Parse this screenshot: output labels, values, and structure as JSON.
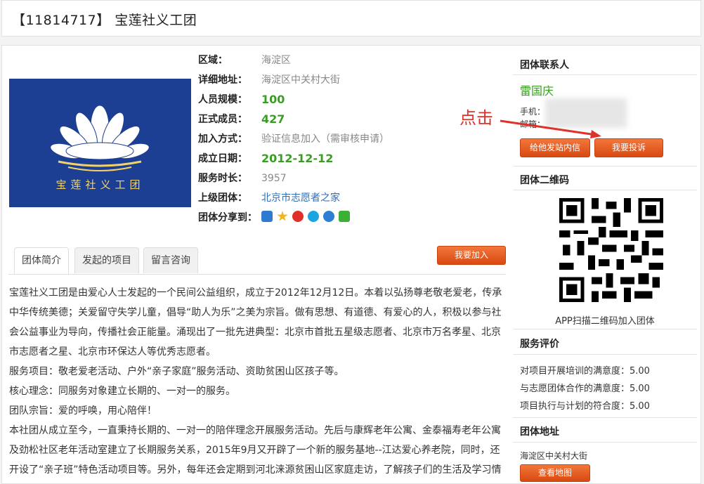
{
  "header": {
    "title": "【11814717】 宝莲社义工团"
  },
  "logo": {
    "text": "宝莲社义工团"
  },
  "info": [
    {
      "label": "区域：",
      "value": "海淀区",
      "style": "gray"
    },
    {
      "label": "详细地址：",
      "value": "海淀区中关村大街",
      "style": "gray"
    },
    {
      "label": "人员规模：",
      "value": "100",
      "style": "green"
    },
    {
      "label": "正式成员：",
      "value": "427",
      "style": "green"
    },
    {
      "label": "加入方式：",
      "value": "验证信息加入（需审核申请）",
      "style": "gray"
    },
    {
      "label": "成立日期：",
      "value": "2012-12-12",
      "style": "green"
    },
    {
      "label": "服务时长：",
      "value": "3957",
      "style": "gray"
    },
    {
      "label": "上级团体：",
      "value": "北京市志愿者之家",
      "style": "link"
    },
    {
      "label": "团体分享到：",
      "value": "",
      "style": "share"
    }
  ],
  "share_icons": [
    "qzone-icon",
    "star-icon",
    "weibo-icon",
    "pengyou-icon",
    "tencent-weibo-icon",
    "wechat-icon"
  ],
  "tabs": [
    "团体简介",
    "发起的项目",
    "留言咨询"
  ],
  "join_button": "我要加入",
  "description": [
    "宝莲社义工团是由爱心人士发起的一个民间公益组织，成立于2012年12月12日。本着以弘扬尊老敬老爱老，传承中华传统美德；关爱留守失学儿童，倡导“助人为乐”之美为宗旨。做有思想、有道德、有爱心的人，积极以参与社会公益事业为导向，传播社会正能量。涌现出了一批先进典型：北京市首批五星级志愿者、北京市万名孝星、北京市志愿者之星、北京市环保达人等优秀志愿者。",
    "服务项目：敬老爱老活动、户外“亲子家庭”服务活动、资助贫困山区孩子等。",
    "核心理念：同服务对象建立长期的、一对一的服务。",
    "团队宗旨：爱的呼唤，用心陪伴！",
    "本社团从成立至今，一直秉持长期的、一对一的陪伴理念开展服务活动。先后与康辉老年公寓、金泰福寿老年公寓及劲松社区老年活动室建立了长期服务关系，2015年9月又开辟了一个新的服务基地--江达爱心养老院，同时，还开设了“亲子班”特色活动项目等。另外，每年还会定期到河北涞源贫困山区家庭走访，了解孩子们的生活及学习情"
  ],
  "sidebar": {
    "contact_title": "团体联系人",
    "contact_name": "雷国庆",
    "phone_label": "手机：",
    "email_label": "邮箱：",
    "message_button": "给他发站内信",
    "complain_button": "我要投诉",
    "qr_title": "团体二维码",
    "qr_caption": "APP扫描二维码加入团体",
    "eval_title": "服务评价",
    "evals": [
      "对项目开展培训的满意度：5.00",
      "与志愿团体合作的满意度：5.00",
      "项目执行与计划的符合度：5.00"
    ],
    "address_title": "团体地址",
    "address": "海淀区中关村大街",
    "map_button": "查看地图"
  },
  "annotation": {
    "text": "点击",
    "color": "#e0302a"
  },
  "colors": {
    "accent_orange": "#e4501b",
    "green": "#3a9d23",
    "link": "#2d6db5",
    "logo_bg": "#1c3f93"
  }
}
